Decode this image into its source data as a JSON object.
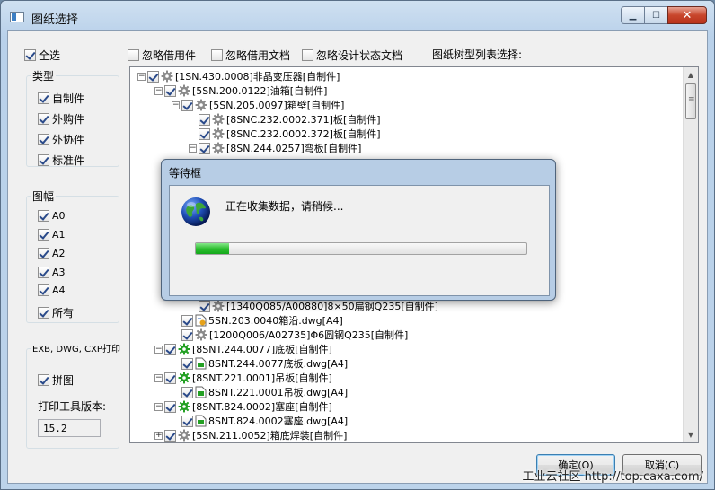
{
  "window": {
    "title": "图纸选择"
  },
  "select_all": {
    "label": "全选",
    "checked": true
  },
  "top_options": [
    {
      "label": "忽略借用件",
      "checked": false
    },
    {
      "label": "忽略借用文档",
      "checked": false
    },
    {
      "label": "忽略设计状态文档",
      "checked": false
    }
  ],
  "tree_caption": "图纸树型列表选择:",
  "type_group": {
    "title": "类型",
    "items": [
      {
        "label": "自制件",
        "checked": true
      },
      {
        "label": "外购件",
        "checked": true
      },
      {
        "label": "外协件",
        "checked": true
      },
      {
        "label": "标准件",
        "checked": true
      }
    ]
  },
  "size_group": {
    "title": "图幅",
    "items": [
      {
        "label": "A0",
        "checked": true
      },
      {
        "label": "A1",
        "checked": true
      },
      {
        "label": "A2",
        "checked": true
      },
      {
        "label": "A3",
        "checked": true
      },
      {
        "label": "A4",
        "checked": true
      },
      {
        "label": "所有",
        "checked": true
      }
    ]
  },
  "print_group": {
    "title": "EXB, DWG, CXP打印",
    "collage": {
      "label": "拼图",
      "checked": true
    },
    "version_label": "打印工具版本:",
    "version_value": "15.2"
  },
  "tree_rows": [
    {
      "level": 0,
      "expander": "−",
      "icon": "gear",
      "text": "[1SN.430.0008]非晶变压器[自制件]"
    },
    {
      "level": 1,
      "expander": "−",
      "icon": "gear",
      "text": "[5SN.200.0122]油箱[自制件]"
    },
    {
      "level": 2,
      "expander": "−",
      "icon": "gear",
      "text": "[5SN.205.0097]箱壁[自制件]"
    },
    {
      "level": 3,
      "expander": "",
      "icon": "gear",
      "text": "[8SNC.232.0002.371]板[自制件]"
    },
    {
      "level": 3,
      "expander": "",
      "icon": "gear",
      "text": "[8SNC.232.0002.372]板[自制件]"
    },
    {
      "level": 3,
      "expander": "−",
      "icon": "gear",
      "text": "[8SN.244.0257]弯板[自制件]"
    },
    {
      "level": 3,
      "expander": "",
      "icon": "gear",
      "text": "[1340Q085/A00880]8×50扁钢Q235[自制件]",
      "row": 16
    },
    {
      "level": 2,
      "expander": "",
      "icon": "dwg",
      "text": "5SN.203.0040箱沿.dwg[A4]",
      "row": 17
    },
    {
      "level": 2,
      "expander": "",
      "icon": "gear",
      "text": "[1200Q006/A02735]Φ6圆钢Q235[自制件]",
      "row": 18
    },
    {
      "level": 1,
      "expander": "−",
      "icon": "gear-green",
      "text": "[8SNT.244.0077]底板[自制件]",
      "row": 19
    },
    {
      "level": 2,
      "expander": "",
      "icon": "dwg-green",
      "text": "8SNT.244.0077底板.dwg[A4]",
      "row": 20
    },
    {
      "level": 1,
      "expander": "−",
      "icon": "gear-green",
      "text": "[8SNT.221.0001]吊板[自制件]",
      "row": 21
    },
    {
      "level": 2,
      "expander": "",
      "icon": "dwg-green",
      "text": "8SNT.221.0001吊板.dwg[A4]",
      "row": 22
    },
    {
      "level": 1,
      "expander": "−",
      "icon": "gear-green",
      "text": "[8SNT.824.0002]塞座[自制件]",
      "row": 23
    },
    {
      "level": 2,
      "expander": "",
      "icon": "dwg-green",
      "text": "8SNT.824.0002塞座.dwg[A4]",
      "row": 24
    },
    {
      "level": 1,
      "expander": "+",
      "icon": "gear",
      "text": "[5SN.211.0052]箱底焊装[自制件]",
      "row": 25
    }
  ],
  "buttons": {
    "ok": "确定(O)",
    "cancel": "取消(C)"
  },
  "watermark": "工业云社区 http://top.caxa.com/",
  "wait_dialog": {
    "title": "等待框",
    "message": "正在收集数据，请稍候...",
    "progress_percent": 10
  },
  "colors": {
    "accent": "#3c7fc4",
    "progress": "#2fbf32"
  }
}
